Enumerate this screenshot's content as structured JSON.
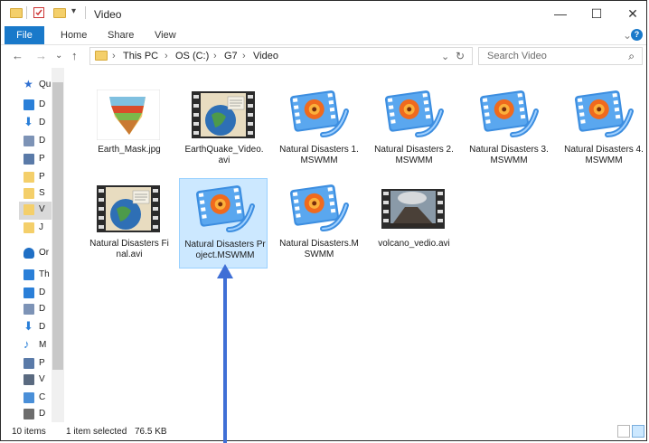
{
  "window": {
    "title": "Video",
    "minimize": "—",
    "maximize": "☐",
    "close": "✕"
  },
  "ribbon": {
    "tabs": [
      "File",
      "Home",
      "Share",
      "View"
    ],
    "expand": "⌄",
    "help": "?"
  },
  "nav": {
    "back": "←",
    "forward": "→",
    "recent": "⌄",
    "up": "↑",
    "breadcrumb": [
      "This PC",
      "OS (C:)",
      "G7",
      "Video"
    ],
    "dropdown": "⌄",
    "refresh": "↻",
    "search_placeholder": "Search Video",
    "search_icon": "⌕"
  },
  "navpane": {
    "items": [
      {
        "label": "Qu",
        "icon": "star-icon",
        "color": "#2f6fd1"
      },
      {
        "label": "D",
        "icon": "desktop-icon",
        "color": "#2a7fd8"
      },
      {
        "label": "D",
        "icon": "download-icon",
        "color": "#2a7fd8"
      },
      {
        "label": "D",
        "icon": "document-icon",
        "color": "#7d93b6"
      },
      {
        "label": "P",
        "icon": "picture-icon",
        "color": "#5a7aa8"
      },
      {
        "label": "P",
        "icon": "folder-icon",
        "color": "#f4cf6a"
      },
      {
        "label": "S",
        "icon": "folder-icon",
        "color": "#f4cf6a"
      },
      {
        "label": "V",
        "icon": "folder-icon",
        "color": "#f4cf6a"
      },
      {
        "label": "J",
        "icon": "folder-icon",
        "color": "#f4cf6a"
      },
      {
        "label": "Or",
        "icon": "cloud-icon",
        "color": "#1f6fc5"
      },
      {
        "label": "Th",
        "icon": "pc-icon",
        "color": "#2a7fd8"
      },
      {
        "label": "D",
        "icon": "desktop-icon",
        "color": "#2a7fd8"
      },
      {
        "label": "D",
        "icon": "document-icon",
        "color": "#7d93b6"
      },
      {
        "label": "D",
        "icon": "download-icon",
        "color": "#2a7fd8"
      },
      {
        "label": "M",
        "icon": "music-icon",
        "color": "#2a7fd8"
      },
      {
        "label": "P",
        "icon": "picture-icon",
        "color": "#5a7aa8"
      },
      {
        "label": "V",
        "icon": "video-icon",
        "color": "#5a6a80"
      },
      {
        "label": "C",
        "icon": "drive-icon",
        "color": "#4a8fd8"
      },
      {
        "label": "D",
        "icon": "drive-icon",
        "color": "#6d6d6d"
      }
    ]
  },
  "files": [
    {
      "name": "Earth_Mask.jpg",
      "type": "image",
      "selected": false
    },
    {
      "name": "EarthQuake_Video.avi",
      "type": "video-map",
      "selected": false
    },
    {
      "name": "Natural Disasters 1.MSWMM",
      "type": "moviemaker",
      "selected": false
    },
    {
      "name": "Natural Disasters 2.MSWMM",
      "type": "moviemaker",
      "selected": false
    },
    {
      "name": "Natural Disasters 3.MSWMM",
      "type": "moviemaker",
      "selected": false
    },
    {
      "name": "Natural Disasters 4.MSWMM",
      "type": "moviemaker",
      "selected": false
    },
    {
      "name": "Natural Disasters Final.avi",
      "type": "video-map",
      "selected": false
    },
    {
      "name": "Natural Disasters Project.MSWMM",
      "type": "moviemaker",
      "selected": true
    },
    {
      "name": "Natural Disasters.MSWMM",
      "type": "moviemaker",
      "selected": false
    },
    {
      "name": "volcano_vedio.avi",
      "type": "video-volcano",
      "selected": false
    }
  ],
  "status": {
    "count": "10 items",
    "selection": "1 item selected",
    "size": "76.5 KB"
  }
}
